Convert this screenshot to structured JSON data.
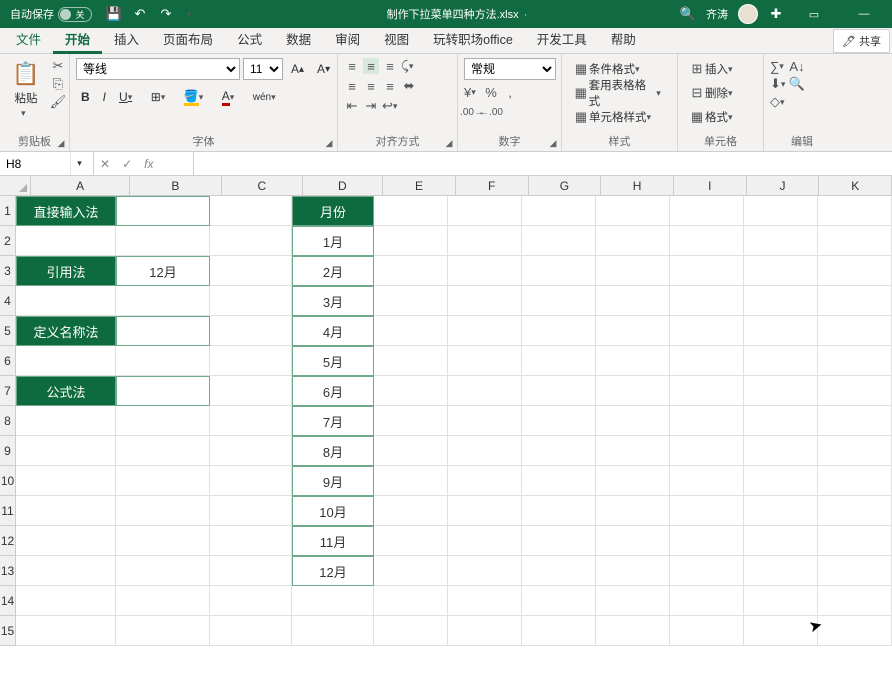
{
  "titlebar": {
    "autosave": "自动保存",
    "autosave_state": "关",
    "filename": "制作下拉菜单四种方法.xlsx",
    "saved_indicator": "·",
    "username": "齐涛"
  },
  "tabs": {
    "file": "文件",
    "home": "开始",
    "insert": "插入",
    "page_layout": "页面布局",
    "formulas": "公式",
    "data": "数据",
    "review": "审阅",
    "view": "视图",
    "custom1": "玩转职场office",
    "developer": "开发工具",
    "help": "帮助",
    "share": "共享"
  },
  "ribbon": {
    "clipboard": {
      "paste": "粘贴",
      "label": "剪贴板"
    },
    "font": {
      "name": "等线",
      "size": "11",
      "wen": "wén",
      "label": "字体",
      "bold": "B",
      "italic": "I",
      "underline": "U"
    },
    "align": {
      "label": "对齐方式"
    },
    "number": {
      "format": "常规",
      "label": "数字"
    },
    "styles": {
      "conditional": "条件格式",
      "table_format": "套用表格格式",
      "cell_styles": "单元格样式",
      "label": "样式"
    },
    "cells": {
      "insert": "插入",
      "delete": "删除",
      "format": "格式",
      "label": "单元格"
    },
    "editing": {
      "label": "编辑"
    }
  },
  "formula_bar": {
    "name_box": "H8",
    "formula": ""
  },
  "columns": [
    "A",
    "B",
    "C",
    "D",
    "E",
    "F",
    "G",
    "H",
    "I",
    "J",
    "K"
  ],
  "rows": [
    "1",
    "2",
    "3",
    "4",
    "5",
    "6",
    "7",
    "8",
    "9",
    "10",
    "11",
    "12",
    "13",
    "14",
    "15"
  ],
  "cells": {
    "A1": "直接输入法",
    "A3": "引用法",
    "B3": "12月",
    "A5": "定义名称法",
    "A7": "公式法",
    "D1": "月份",
    "months": [
      "1月",
      "2月",
      "3月",
      "4月",
      "5月",
      "6月",
      "7月",
      "8月",
      "9月",
      "10月",
      "11月",
      "12月"
    ]
  },
  "chart_data": {
    "type": "table",
    "title": "月份",
    "categories": [
      "1月",
      "2月",
      "3月",
      "4月",
      "5月",
      "6月",
      "7月",
      "8月",
      "9月",
      "10月",
      "11月",
      "12月"
    ]
  }
}
